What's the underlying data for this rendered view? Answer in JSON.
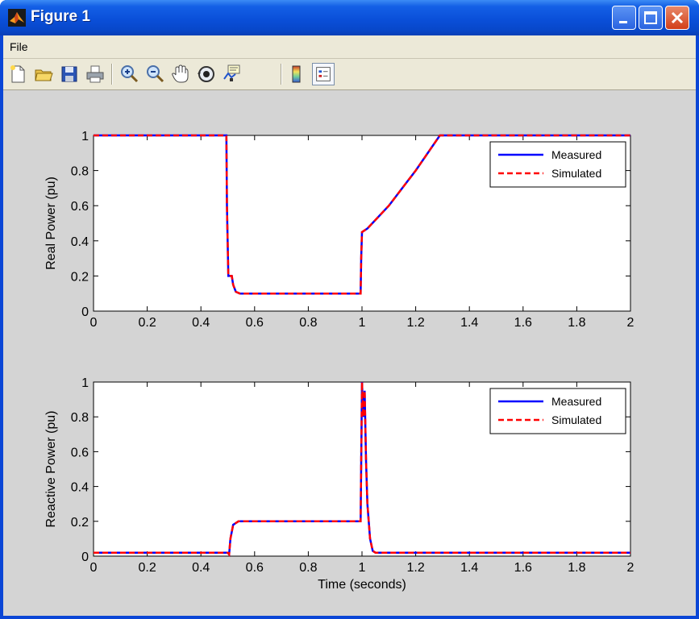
{
  "window": {
    "title": "Figure 1",
    "icon": "matlab-logo-icon",
    "controls": [
      "minimize-icon",
      "maximize-icon",
      "close-icon"
    ]
  },
  "menu": {
    "items": [
      "File"
    ]
  },
  "toolbar": {
    "buttons": [
      "new-figure-icon",
      "open-file-icon",
      "save-icon",
      "print-icon",
      "zoom-in-icon",
      "zoom-out-icon",
      "pan-hand-icon",
      "rotate-3d-icon",
      "data-cursor-icon",
      "colorbar-icon",
      "legend-icon"
    ]
  },
  "colors": {
    "measured": "#0000ff",
    "simulated": "#ff0000"
  },
  "chart_data": [
    {
      "type": "line",
      "ylabel": "Real Power (pu)",
      "xlabel": "",
      "xlim": [
        0,
        2
      ],
      "ylim": [
        0,
        1
      ],
      "xticks": [
        "0",
        "0.2",
        "0.4",
        "0.6",
        "0.8",
        "1",
        "1.2",
        "1.4",
        "1.6",
        "1.8",
        "2"
      ],
      "yticks": [
        "0",
        "0.2",
        "0.4",
        "0.6",
        "0.8",
        "1"
      ],
      "legend_position": "top-right",
      "series": [
        {
          "name": "Measured",
          "style": "solid",
          "x": [
            0,
            0.495,
            0.497,
            0.502,
            0.51,
            0.515,
            0.52,
            0.53,
            0.545,
            0.6,
            0.8,
            0.995,
            0.997,
            1.0,
            1.02,
            1.1,
            1.2,
            1.29,
            1.3,
            2.0
          ],
          "y": [
            1,
            1,
            0.6,
            0.2,
            0.2,
            0.2,
            0.15,
            0.11,
            0.1,
            0.1,
            0.1,
            0.1,
            0.3,
            0.45,
            0.47,
            0.6,
            0.8,
            1,
            1,
            1
          ]
        },
        {
          "name": "Simulated",
          "style": "dashed",
          "x": [
            0,
            0.495,
            0.497,
            0.502,
            0.51,
            0.515,
            0.52,
            0.53,
            0.545,
            0.6,
            0.8,
            0.995,
            0.997,
            1.0,
            1.02,
            1.1,
            1.2,
            1.29,
            1.3,
            2.0
          ],
          "y": [
            1,
            1,
            0.6,
            0.2,
            0.2,
            0.2,
            0.15,
            0.11,
            0.1,
            0.1,
            0.1,
            0.1,
            0.3,
            0.45,
            0.47,
            0.6,
            0.8,
            1,
            1,
            1
          ]
        }
      ]
    },
    {
      "type": "line",
      "ylabel": "Reactive Power (pu)",
      "xlabel": "Time (seconds)",
      "xlim": [
        0,
        2
      ],
      "ylim": [
        0,
        1
      ],
      "xticks": [
        "0",
        "0.2",
        "0.4",
        "0.6",
        "0.8",
        "1",
        "1.2",
        "1.4",
        "1.6",
        "1.8",
        "2"
      ],
      "yticks": [
        "0",
        "0.2",
        "0.4",
        "0.6",
        "0.8",
        "1"
      ],
      "legend_position": "top-right",
      "series": [
        {
          "name": "Measured",
          "style": "solid",
          "x": [
            0,
            0.5,
            0.505,
            0.51,
            0.52,
            0.54,
            0.6,
            0.8,
            0.995,
            1.0,
            1.005,
            1.01,
            1.015,
            1.02,
            1.03,
            1.04,
            1.05,
            1.2,
            2.0
          ],
          "y": [
            0.02,
            0.02,
            0.01,
            0.1,
            0.18,
            0.2,
            0.2,
            0.2,
            0.2,
            1.0,
            0.8,
            0.95,
            0.55,
            0.3,
            0.1,
            0.03,
            0.02,
            0.02,
            0.02
          ]
        },
        {
          "name": "Simulated",
          "style": "dashed",
          "x": [
            0,
            0.5,
            0.505,
            0.51,
            0.52,
            0.54,
            0.6,
            0.8,
            0.995,
            1.0,
            1.005,
            1.01,
            1.015,
            1.02,
            1.03,
            1.04,
            1.05,
            1.2,
            2.0
          ],
          "y": [
            0.02,
            0.02,
            0.01,
            0.1,
            0.18,
            0.2,
            0.2,
            0.2,
            0.2,
            1.0,
            0.8,
            0.95,
            0.55,
            0.3,
            0.1,
            0.03,
            0.02,
            0.02,
            0.02
          ]
        }
      ]
    }
  ]
}
